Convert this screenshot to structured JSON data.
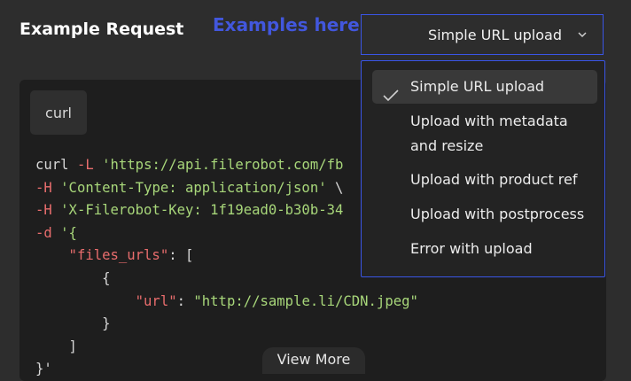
{
  "header": {
    "title": "Example Request",
    "annotation": "Examples here"
  },
  "select": {
    "value": "Simple URL upload",
    "icon": "chevron-down-icon"
  },
  "code_panel": {
    "tab_label": "curl",
    "lines": {
      "l1_cmd": "curl ",
      "l1_flag": "-L",
      "l1_url": " 'https://api.filerobot.com/fb",
      "l2_flag": "-H",
      "l2_val": " 'Content-Type: application/json'",
      "l2_rest": " \\",
      "l3_flag": "-H",
      "l3_val": " 'X-Filerobot-Key: 1f19ead0-b30b-34",
      "l4_flag": "-d",
      "l4_val": " '{",
      "l5_key": "    \"files_urls\"",
      "l5_rest": ": [",
      "l6": "        {",
      "l7_key": "            \"url\"",
      "l7_colon": ": ",
      "l7_val": "\"http://sample.li/CDN.jpeg\"",
      "l8": "        }",
      "l9": "    ]",
      "l10": "}'"
    },
    "view_more": "View More"
  },
  "dropdown": {
    "items": [
      {
        "label": "Simple URL upload",
        "selected": true
      },
      {
        "label_line1": "Upload with metadata",
        "label_line2": "and resize"
      },
      {
        "label": "Upload with product ref"
      },
      {
        "label": "Upload with postprocess"
      },
      {
        "label": "Error with upload"
      }
    ]
  },
  "colors": {
    "accent_border": "#3a55e6",
    "annotation": "#4257dd",
    "code_flag": "#e96d6d",
    "code_string": "#a8d77a"
  }
}
